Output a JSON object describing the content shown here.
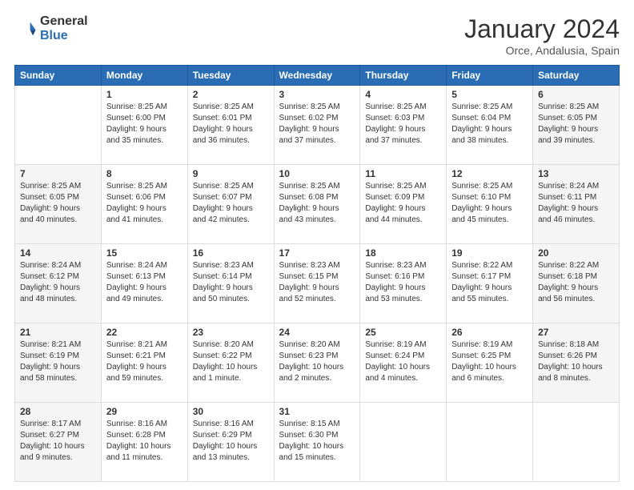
{
  "header": {
    "logo_general": "General",
    "logo_blue": "Blue",
    "month_title": "January 2024",
    "location": "Orce, Andalusia, Spain"
  },
  "days_of_week": [
    "Sunday",
    "Monday",
    "Tuesday",
    "Wednesday",
    "Thursday",
    "Friday",
    "Saturday"
  ],
  "weeks": [
    [
      {
        "day": "",
        "info": ""
      },
      {
        "day": "1",
        "info": "Sunrise: 8:25 AM\nSunset: 6:00 PM\nDaylight: 9 hours\nand 35 minutes."
      },
      {
        "day": "2",
        "info": "Sunrise: 8:25 AM\nSunset: 6:01 PM\nDaylight: 9 hours\nand 36 minutes."
      },
      {
        "day": "3",
        "info": "Sunrise: 8:25 AM\nSunset: 6:02 PM\nDaylight: 9 hours\nand 37 minutes."
      },
      {
        "day": "4",
        "info": "Sunrise: 8:25 AM\nSunset: 6:03 PM\nDaylight: 9 hours\nand 37 minutes."
      },
      {
        "day": "5",
        "info": "Sunrise: 8:25 AM\nSunset: 6:04 PM\nDaylight: 9 hours\nand 38 minutes."
      },
      {
        "day": "6",
        "info": "Sunrise: 8:25 AM\nSunset: 6:05 PM\nDaylight: 9 hours\nand 39 minutes."
      }
    ],
    [
      {
        "day": "7",
        "info": "Sunrise: 8:25 AM\nSunset: 6:05 PM\nDaylight: 9 hours\nand 40 minutes."
      },
      {
        "day": "8",
        "info": "Sunrise: 8:25 AM\nSunset: 6:06 PM\nDaylight: 9 hours\nand 41 minutes."
      },
      {
        "day": "9",
        "info": "Sunrise: 8:25 AM\nSunset: 6:07 PM\nDaylight: 9 hours\nand 42 minutes."
      },
      {
        "day": "10",
        "info": "Sunrise: 8:25 AM\nSunset: 6:08 PM\nDaylight: 9 hours\nand 43 minutes."
      },
      {
        "day": "11",
        "info": "Sunrise: 8:25 AM\nSunset: 6:09 PM\nDaylight: 9 hours\nand 44 minutes."
      },
      {
        "day": "12",
        "info": "Sunrise: 8:25 AM\nSunset: 6:10 PM\nDaylight: 9 hours\nand 45 minutes."
      },
      {
        "day": "13",
        "info": "Sunrise: 8:24 AM\nSunset: 6:11 PM\nDaylight: 9 hours\nand 46 minutes."
      }
    ],
    [
      {
        "day": "14",
        "info": "Sunrise: 8:24 AM\nSunset: 6:12 PM\nDaylight: 9 hours\nand 48 minutes."
      },
      {
        "day": "15",
        "info": "Sunrise: 8:24 AM\nSunset: 6:13 PM\nDaylight: 9 hours\nand 49 minutes."
      },
      {
        "day": "16",
        "info": "Sunrise: 8:23 AM\nSunset: 6:14 PM\nDaylight: 9 hours\nand 50 minutes."
      },
      {
        "day": "17",
        "info": "Sunrise: 8:23 AM\nSunset: 6:15 PM\nDaylight: 9 hours\nand 52 minutes."
      },
      {
        "day": "18",
        "info": "Sunrise: 8:23 AM\nSunset: 6:16 PM\nDaylight: 9 hours\nand 53 minutes."
      },
      {
        "day": "19",
        "info": "Sunrise: 8:22 AM\nSunset: 6:17 PM\nDaylight: 9 hours\nand 55 minutes."
      },
      {
        "day": "20",
        "info": "Sunrise: 8:22 AM\nSunset: 6:18 PM\nDaylight: 9 hours\nand 56 minutes."
      }
    ],
    [
      {
        "day": "21",
        "info": "Sunrise: 8:21 AM\nSunset: 6:19 PM\nDaylight: 9 hours\nand 58 minutes."
      },
      {
        "day": "22",
        "info": "Sunrise: 8:21 AM\nSunset: 6:21 PM\nDaylight: 9 hours\nand 59 minutes."
      },
      {
        "day": "23",
        "info": "Sunrise: 8:20 AM\nSunset: 6:22 PM\nDaylight: 10 hours\nand 1 minute."
      },
      {
        "day": "24",
        "info": "Sunrise: 8:20 AM\nSunset: 6:23 PM\nDaylight: 10 hours\nand 2 minutes."
      },
      {
        "day": "25",
        "info": "Sunrise: 8:19 AM\nSunset: 6:24 PM\nDaylight: 10 hours\nand 4 minutes."
      },
      {
        "day": "26",
        "info": "Sunrise: 8:19 AM\nSunset: 6:25 PM\nDaylight: 10 hours\nand 6 minutes."
      },
      {
        "day": "27",
        "info": "Sunrise: 8:18 AM\nSunset: 6:26 PM\nDaylight: 10 hours\nand 8 minutes."
      }
    ],
    [
      {
        "day": "28",
        "info": "Sunrise: 8:17 AM\nSunset: 6:27 PM\nDaylight: 10 hours\nand 9 minutes."
      },
      {
        "day": "29",
        "info": "Sunrise: 8:16 AM\nSunset: 6:28 PM\nDaylight: 10 hours\nand 11 minutes."
      },
      {
        "day": "30",
        "info": "Sunrise: 8:16 AM\nSunset: 6:29 PM\nDaylight: 10 hours\nand 13 minutes."
      },
      {
        "day": "31",
        "info": "Sunrise: 8:15 AM\nSunset: 6:30 PM\nDaylight: 10 hours\nand 15 minutes."
      },
      {
        "day": "",
        "info": ""
      },
      {
        "day": "",
        "info": ""
      },
      {
        "day": "",
        "info": ""
      }
    ]
  ]
}
